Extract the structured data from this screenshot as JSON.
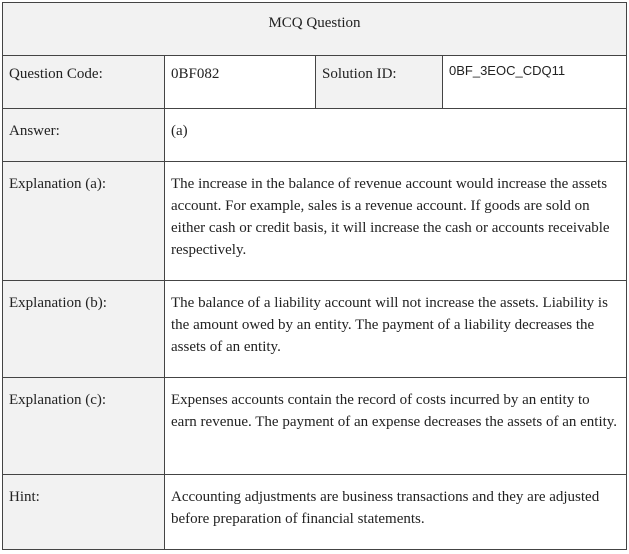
{
  "title": "MCQ Question",
  "question_code": {
    "label": "Question Code:",
    "value": "0BF082"
  },
  "solution_id": {
    "label": "Solution ID:",
    "value": "0BF_3EOC_CDQ11"
  },
  "answer": {
    "label": "Answer:",
    "value": "(a)"
  },
  "explanation_a": {
    "label": "Explanation (a):",
    "text": "The increase in the balance of revenue account would increase the assets account. For example, sales is a revenue account. If goods are sold on either cash or credit basis, it will increase the cash or accounts receivable respectively."
  },
  "explanation_b": {
    "label": "Explanation (b):",
    "text": "The balance of a liability account will not increase the assets. Liability is the amount owed by an entity. The payment of a liability decreases the assets of an entity."
  },
  "explanation_c": {
    "label": "Explanation (c):",
    "text": "Expenses accounts contain the record of costs incurred by an entity to earn revenue. The payment of an expense decreases the assets of an entity."
  },
  "hint": {
    "label": "Hint:",
    "text": "Accounting adjustments are business transactions and they are adjusted before preparation of financial statements."
  }
}
